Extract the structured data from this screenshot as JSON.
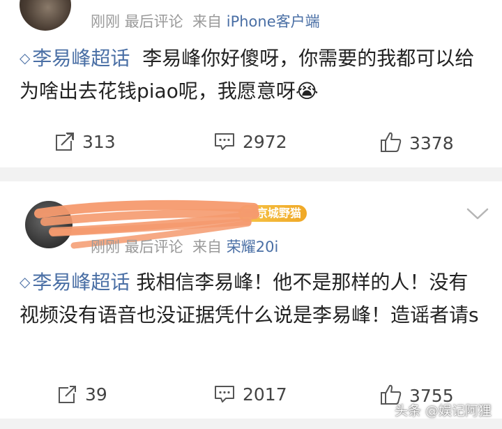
{
  "post1": {
    "meta_time": "刚刚",
    "meta_type": "最后评论",
    "meta_from": "来自",
    "meta_source": "iPhone客户端",
    "topic": "李易峰超话",
    "text": "李易峰你好傻呀，你需要的我都可以给为啥出去花钱piao呢，我愿意呀",
    "emoji": "😭",
    "reposts": "313",
    "comments": "2972",
    "likes": "3378"
  },
  "post2": {
    "badge": "京城野猫",
    "meta_time": "刚刚",
    "meta_type": "最后评论",
    "meta_from": "来自",
    "meta_source": "荣耀20i",
    "topic": "李易峰超话",
    "text": "我相信李易峰！他不是那样的人！没有视频没有语音也没证据凭什么说是李易峰！造谣者请s",
    "reposts": "39",
    "comments": "2017",
    "likes": "3755"
  },
  "watermark": "头条 @娱记阿狸",
  "icons": {
    "topic": "diamond-icon",
    "repost": "repost-icon",
    "comment": "comment-icon",
    "like": "thumbs-up-icon",
    "menu": "chevron-down-icon"
  },
  "colors": {
    "link": "#4a6fa5",
    "meta": "#9a9a9a",
    "divider": "#f2f2f2",
    "scribble": "#f59a6e",
    "badge": "#f0a826"
  }
}
